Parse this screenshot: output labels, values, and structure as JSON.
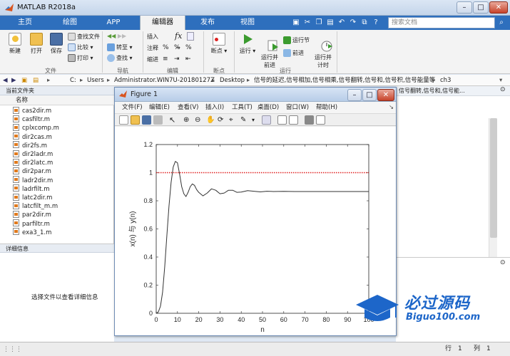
{
  "window": {
    "title": "MATLAB R2018a",
    "btn_min": "–",
    "btn_max": "□",
    "btn_close": "✕"
  },
  "tabs": [
    "主页",
    "绘图",
    "APP",
    "编辑器",
    "发布",
    "视图"
  ],
  "search": {
    "placeholder": "搜索文档"
  },
  "ribbon": {
    "new": "新建",
    "open": "打开",
    "save": "保存",
    "find_files": "查找文件",
    "compare": "比较",
    "print": "打印",
    "goto": "转至",
    "find": "查找",
    "insert": "插入",
    "comment": "注释",
    "indent": "缩进",
    "fx": "fx",
    "breakpoints": "断点",
    "run": "运行",
    "run_advance": "运行并\n前进",
    "run_section": "运行节",
    "advance": "前进",
    "run_time": "运行并\n计时",
    "groups": {
      "file": "文件",
      "navigate": "导航",
      "edit": "编辑",
      "breakpoints": "断点",
      "run": "运行"
    }
  },
  "address": {
    "segments": [
      "C:",
      "Users",
      "Administrator.WIN7U-20180127Z",
      "Desktop",
      "信号的延迟,信号相加,信号相乘,信号翻转,信号和,信号积,信号能量等",
      "ch3"
    ],
    "overflow": "信号翻转,信号和,信号能..."
  },
  "current_folder": {
    "header": "当前文件夹",
    "column": "名称",
    "files": [
      "cas2dir.m",
      "casfiltr.m",
      "cplxcomp.m",
      "dir2cas.m",
      "dir2fs.m",
      "dir2ladr.m",
      "dir2latc.m",
      "dir2par.m",
      "ladr2dir.m",
      "ladrfilt.m",
      "latc2dir.m",
      "latcfilt_m.m",
      "par2dir.m",
      "parfiltr.m",
      "exa3_1.m"
    ]
  },
  "details": {
    "header": "详细信息",
    "message": "选择文件以查看详细信息"
  },
  "status": {
    "row_label": "行",
    "row": "1",
    "col_label": "列",
    "col": "1"
  },
  "figure": {
    "title": "Figure 1",
    "menu": [
      "文件(F)",
      "编辑(E)",
      "查看(V)",
      "插入(I)",
      "工具(T)",
      "桌面(D)",
      "窗口(W)",
      "帮助(H)"
    ]
  },
  "watermark": {
    "text": "必过源码",
    "url": "Biguo100.com"
  },
  "colors": {
    "tabstrip": "#2e6fbd",
    "reference_line": "#e02020",
    "response_line": "#333333"
  },
  "chart_data": {
    "type": "line",
    "xlabel": "n",
    "ylabel": "x(n) 与 y(n)",
    "xlim": [
      0,
      100
    ],
    "ylim": [
      0,
      1.2
    ],
    "xticks": [
      0,
      10,
      20,
      30,
      40,
      50,
      60,
      70,
      80,
      90,
      100
    ],
    "yticks": [
      0,
      0.2,
      0.4,
      0.6,
      0.8,
      1,
      1.2
    ],
    "series": [
      {
        "style": "dotted-red",
        "x": [
          0,
          100
        ],
        "y": [
          1,
          1
        ]
      },
      {
        "style": "solid-dark",
        "x": [
          0,
          1,
          2,
          3,
          4,
          5,
          6,
          7,
          8,
          9,
          10,
          11,
          12,
          13,
          14,
          15,
          16,
          17,
          18,
          19,
          20,
          22,
          24,
          26,
          28,
          30,
          32,
          34,
          36,
          38,
          40,
          43,
          46,
          49,
          52,
          55,
          60,
          65,
          70,
          80,
          90,
          100
        ],
        "y": [
          0,
          0.01,
          0.05,
          0.15,
          0.33,
          0.55,
          0.76,
          0.93,
          1.04,
          1.08,
          1.07,
          0.99,
          0.9,
          0.85,
          0.83,
          0.86,
          0.9,
          0.92,
          0.91,
          0.88,
          0.86,
          0.835,
          0.855,
          0.885,
          0.875,
          0.85,
          0.855,
          0.875,
          0.875,
          0.86,
          0.862,
          0.872,
          0.868,
          0.863,
          0.868,
          0.866,
          0.867,
          0.866,
          0.866,
          0.866,
          0.866,
          0.866
        ]
      }
    ]
  }
}
